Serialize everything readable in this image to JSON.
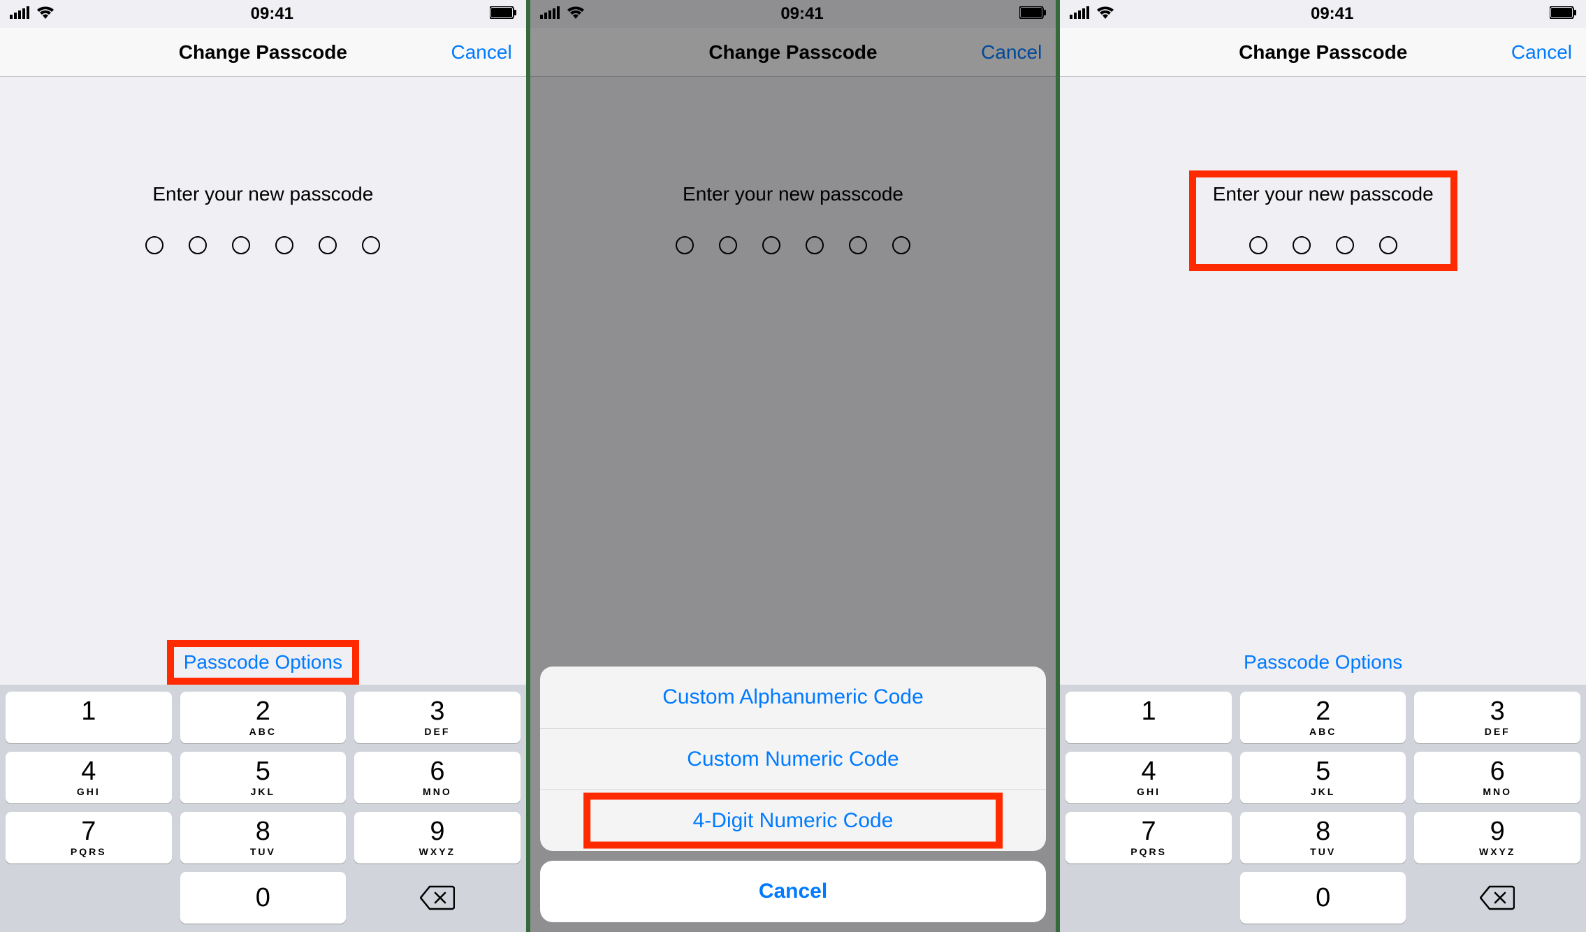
{
  "status": {
    "time": "09:41"
  },
  "nav": {
    "title": "Change Passcode",
    "cancel": "Cancel"
  },
  "prompt": "Enter your new passcode",
  "dotCounts": {
    "six": 6,
    "four": 4
  },
  "optionsLabel": "Passcode Options",
  "sheet": {
    "items": [
      "Custom Alphanumeric Code",
      "Custom Numeric Code",
      "4-Digit Numeric Code"
    ],
    "cancel": "Cancel"
  },
  "keypad": [
    {
      "digit": "1",
      "letters": ""
    },
    {
      "digit": "2",
      "letters": "ABC"
    },
    {
      "digit": "3",
      "letters": "DEF"
    },
    {
      "digit": "4",
      "letters": "GHI"
    },
    {
      "digit": "5",
      "letters": "JKL"
    },
    {
      "digit": "6",
      "letters": "MNO"
    },
    {
      "digit": "7",
      "letters": "PQRS"
    },
    {
      "digit": "8",
      "letters": "TUV"
    },
    {
      "digit": "9",
      "letters": "WXYZ"
    },
    {
      "digit": "0",
      "letters": ""
    }
  ]
}
